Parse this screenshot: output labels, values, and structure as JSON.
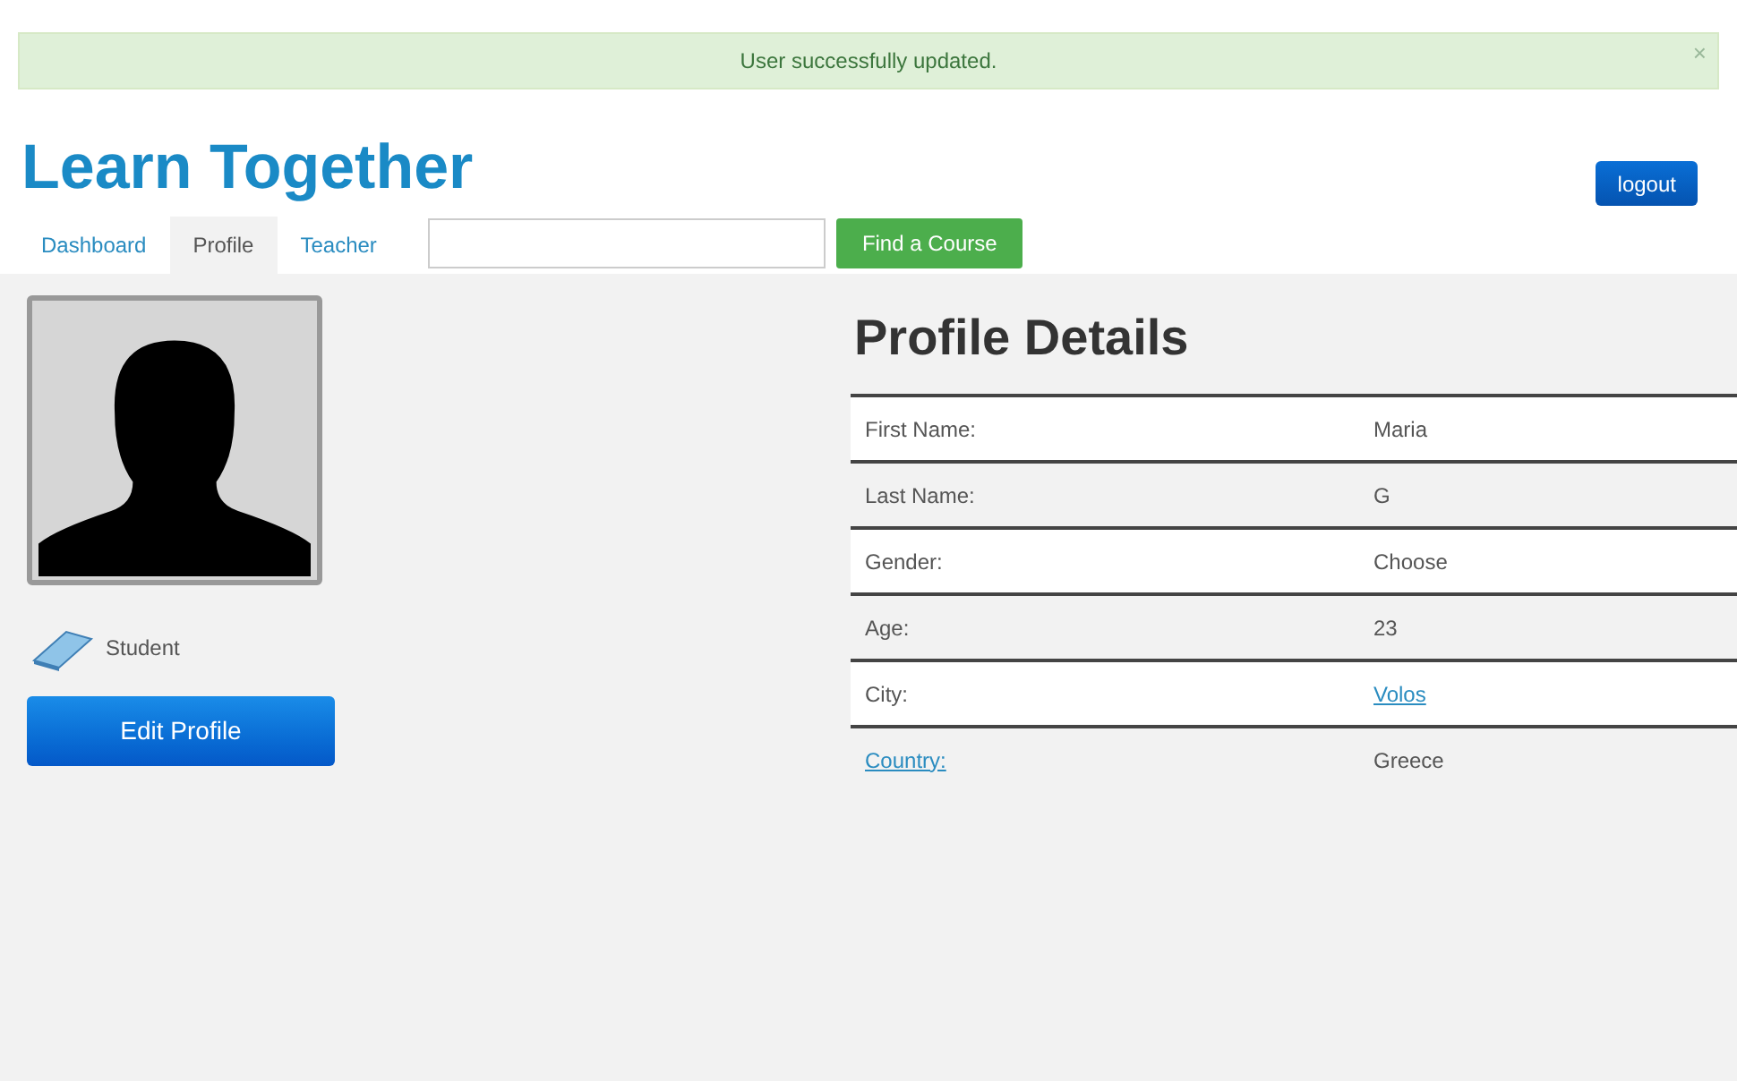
{
  "alert": {
    "message": "User successfully updated.",
    "close": "×"
  },
  "header": {
    "title": "Learn Together",
    "logout": "logout"
  },
  "tabs": [
    {
      "label": "Dashboard",
      "selected": false
    },
    {
      "label": "Profile",
      "selected": true
    },
    {
      "label": "Teacher",
      "selected": false
    }
  ],
  "search": {
    "button": "Find a Course"
  },
  "profile": {
    "role": "Student",
    "edit_button": "Edit Profile"
  },
  "details": {
    "title": "Profile Details",
    "rows": [
      {
        "label": "First Name:",
        "value": "Maria",
        "label_link": false,
        "value_link": false
      },
      {
        "label": "Last Name:",
        "value": "G",
        "label_link": false,
        "value_link": false
      },
      {
        "label": "Gender:",
        "value": "Choose",
        "label_link": false,
        "value_link": false
      },
      {
        "label": "Age:",
        "value": "23",
        "label_link": false,
        "value_link": false
      },
      {
        "label": "City:",
        "value": "Volos",
        "label_link": false,
        "value_link": true
      },
      {
        "label": "Country:",
        "value": "Greece",
        "label_link": true,
        "value_link": false
      }
    ]
  }
}
